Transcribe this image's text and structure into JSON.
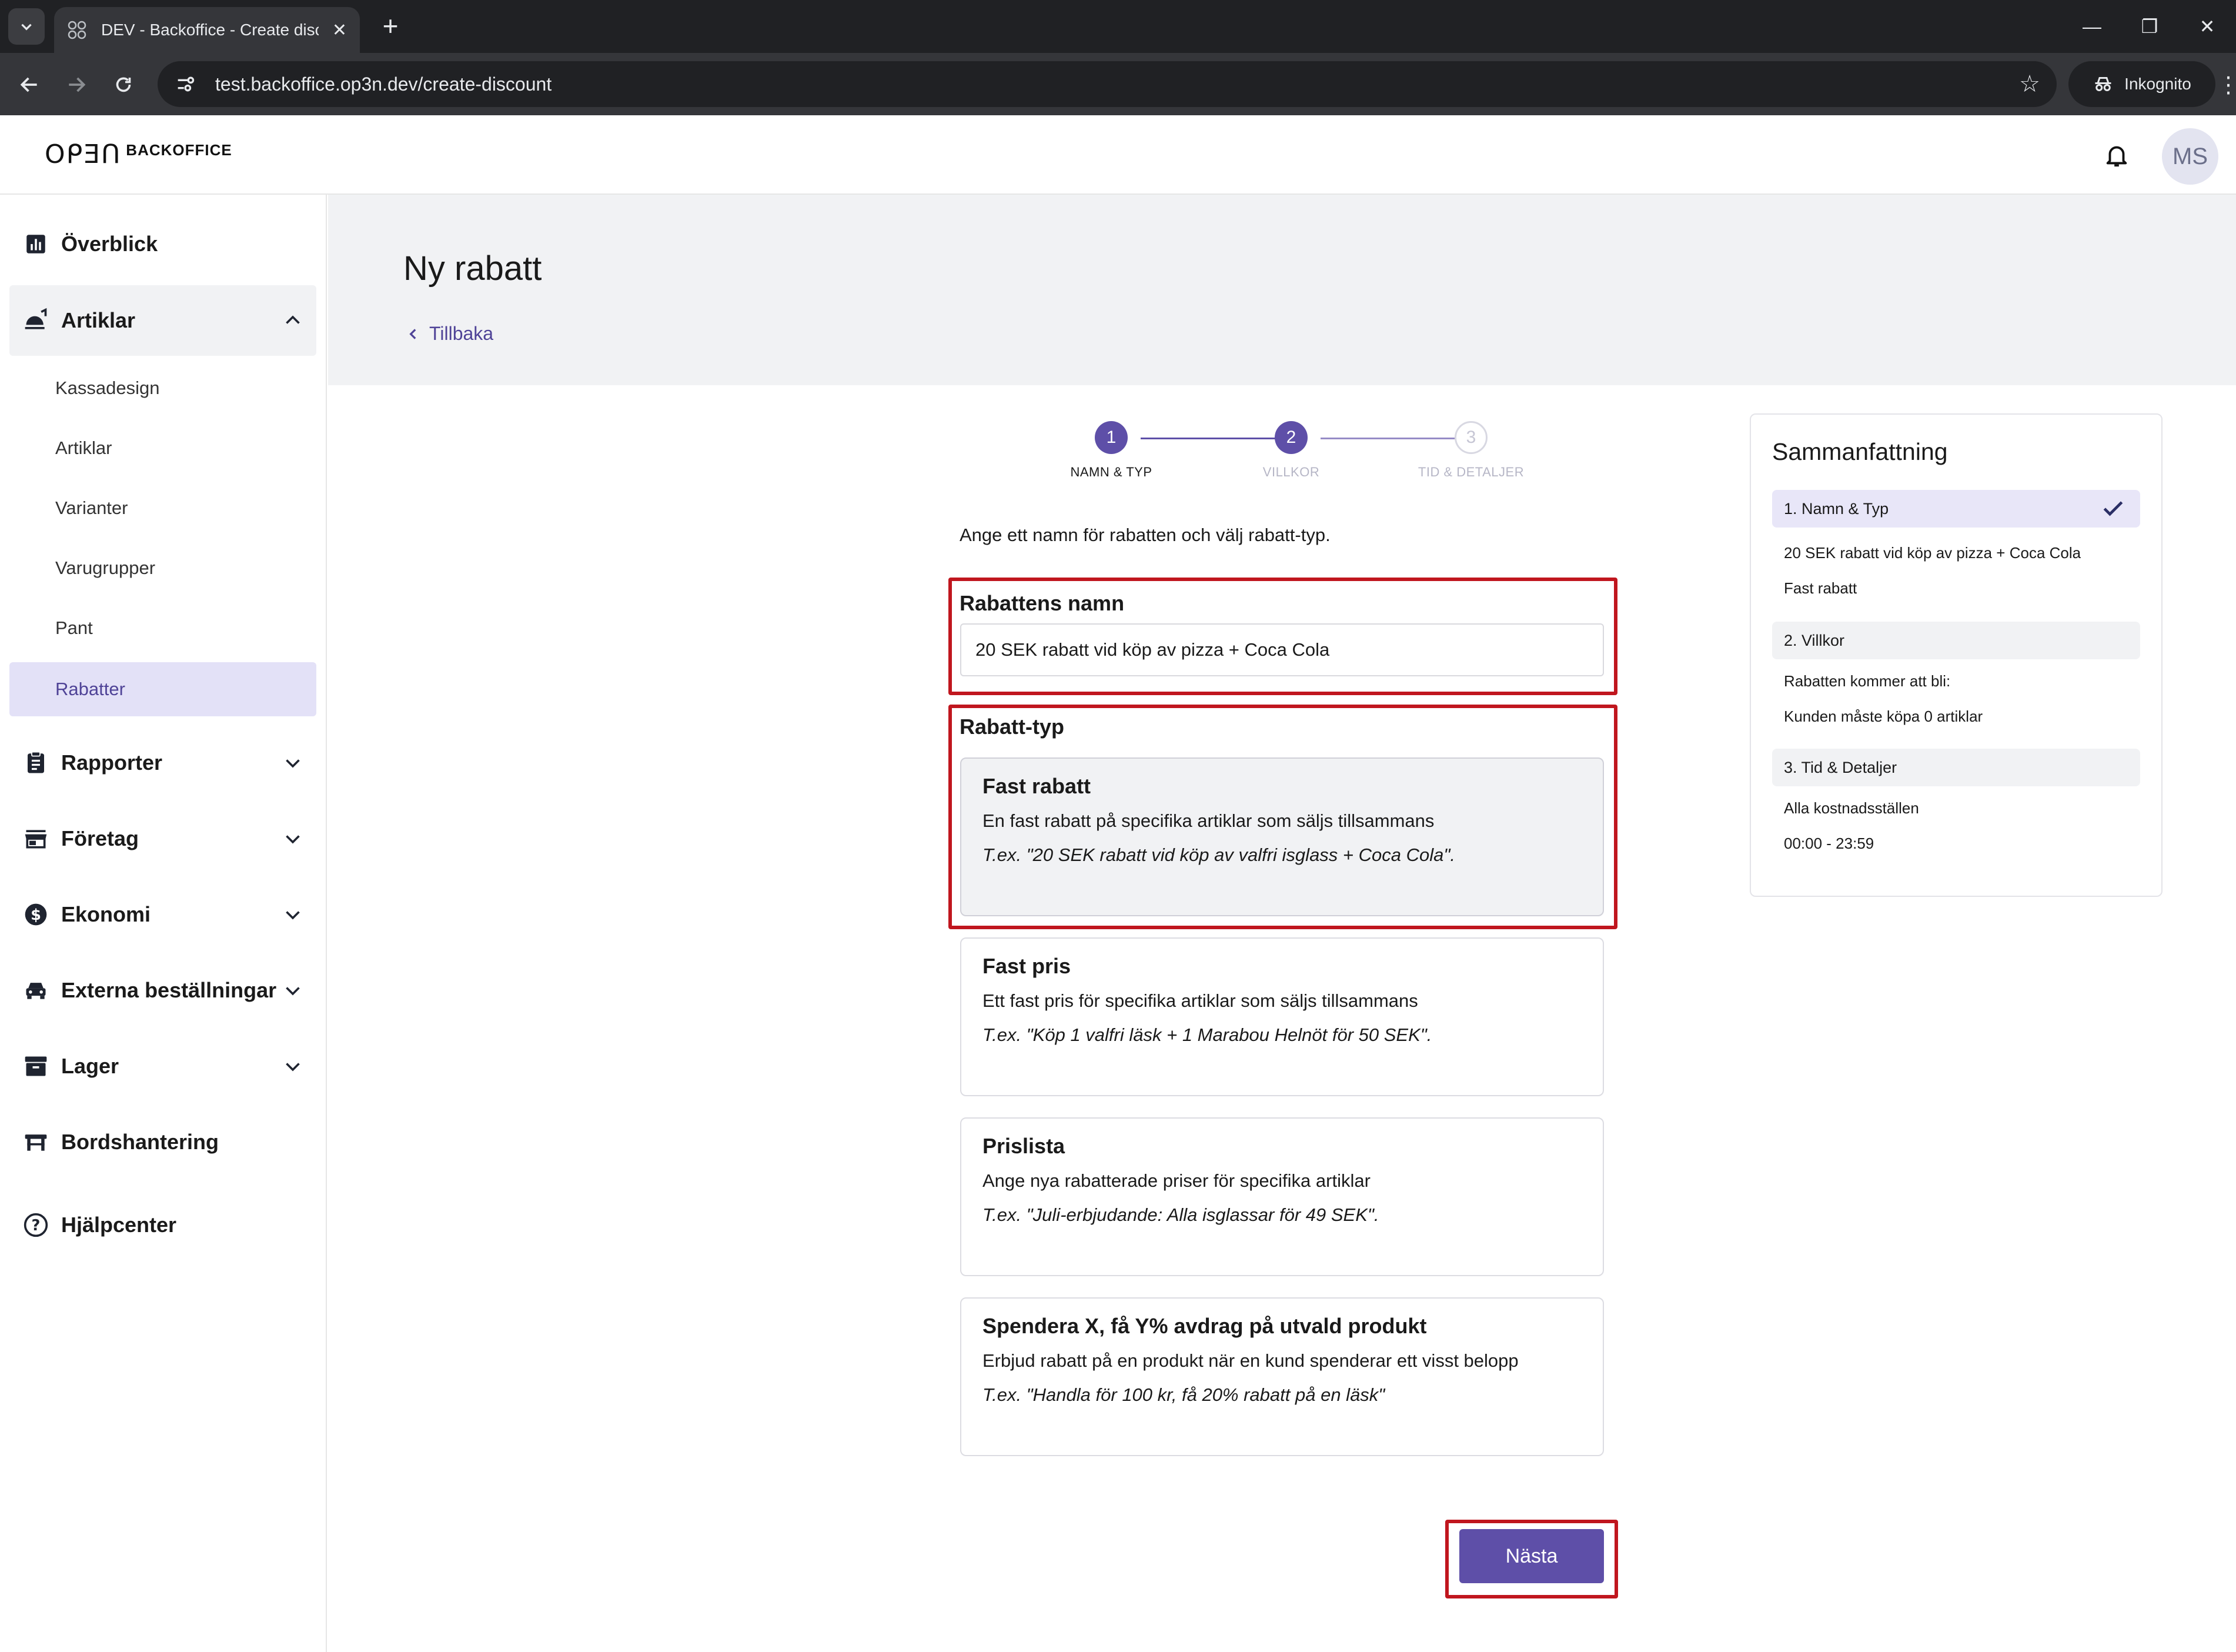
{
  "browser": {
    "tab_title": "DEV - Backoffice - Create disco",
    "url": "test.backoffice.op3n.dev/create-discount",
    "incognito_label": "Inkognito"
  },
  "header": {
    "logo_mark": "OᑭƎᑎ",
    "logo_text": "BACKOFFICE",
    "avatar_initials": "MS"
  },
  "sidebar": {
    "items": [
      {
        "label": "Överblick",
        "icon": "bar-chart-icon"
      },
      {
        "label": "Artiklar",
        "icon": "food-tray-icon"
      },
      {
        "label": "Rapporter",
        "icon": "clipboard-icon"
      },
      {
        "label": "Företag",
        "icon": "store-icon"
      },
      {
        "label": "Ekonomi",
        "icon": "dollar-circle-icon"
      },
      {
        "label": "Externa beställningar",
        "icon": "car-icon"
      },
      {
        "label": "Lager",
        "icon": "archive-box-icon"
      },
      {
        "label": "Bordshantering",
        "icon": "table-icon"
      },
      {
        "label": "Hjälpcenter",
        "icon": "help-circle-icon"
      }
    ],
    "subitems": [
      "Kassadesign",
      "Artiklar",
      "Varianter",
      "Varugrupper",
      "Pant",
      "Rabatter"
    ]
  },
  "main": {
    "title": "Ny rabatt",
    "back_label": "Tillbaka",
    "steps": [
      {
        "number": "1",
        "label": "NAMN & TYP"
      },
      {
        "number": "2",
        "label": "VILLKOR"
      },
      {
        "number": "3",
        "label": "TID & DETALJER"
      }
    ],
    "intro": "Ange ett namn för rabatten och välj rabatt-typ.",
    "name_label": "Rabattens namn",
    "name_value": "20 SEK rabatt vid köp av pizza + Coca Cola",
    "type_label": "Rabatt-typ",
    "options": [
      {
        "title": "Fast rabatt",
        "desc": "En fast rabatt på specifika artiklar som säljs tillsammans",
        "example": "T.ex. \"20 SEK rabatt vid köp av valfri isglass + Coca Cola\"."
      },
      {
        "title": "Fast pris",
        "desc": "Ett fast pris för specifika artiklar som säljs tillsammans",
        "example": "T.ex. \"Köp 1 valfri läsk + 1 Marabou Helnöt för 50 SEK\"."
      },
      {
        "title": "Prislista",
        "desc": "Ange nya rabatterade priser för specifika artiklar",
        "example": "T.ex. \"Juli-erbjudande: Alla isglassar för 49 SEK\"."
      },
      {
        "title": "Spendera X, få Y% avdrag på utvald produkt",
        "desc": "Erbjud rabatt på en produkt när en kund spenderar ett visst belopp",
        "example": "T.ex. \"Handla för 100 kr, få 20% rabatt på en läsk\""
      }
    ],
    "next_label": "Nästa"
  },
  "summary": {
    "title": "Sammanfattning",
    "sections": [
      {
        "heading": "1. Namn & Typ",
        "lines": [
          "20 SEK rabatt vid köp av pizza + Coca Cola",
          "Fast rabatt"
        ]
      },
      {
        "heading": "2. Villkor",
        "lines": [
          "Rabatten kommer att bli:",
          "Kunden måste köpa 0 artiklar"
        ]
      },
      {
        "heading": "3. Tid & Detaljer",
        "lines": [
          "Alla kostnadsställen",
          "00:00 - 23:59"
        ]
      }
    ]
  },
  "colors": {
    "accent": "#5e4fa8",
    "highlight_red": "#c0161e",
    "selected_nav": "#e3e1f7"
  }
}
